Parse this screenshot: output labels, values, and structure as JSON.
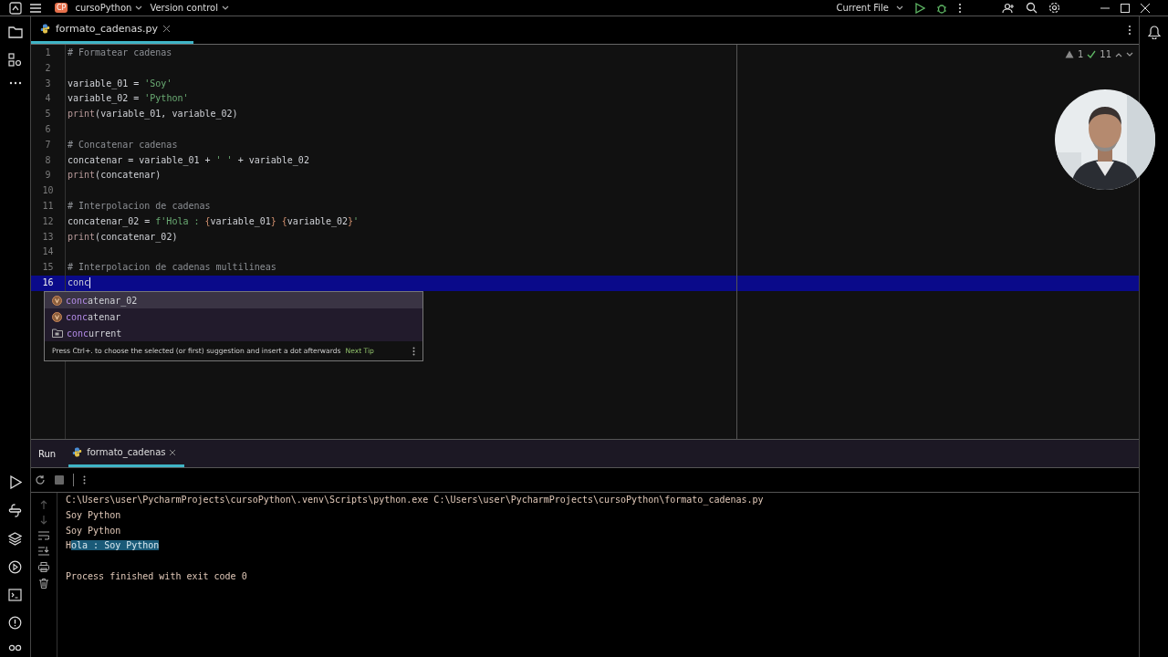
{
  "title_bar": {
    "project_badge": "CP",
    "project": "cursoPython",
    "vcs": "Version control",
    "run_config": "Current File"
  },
  "editor": {
    "tab": {
      "label": "formato_cadenas.py",
      "selected": true
    },
    "inspections": {
      "warnings": "1",
      "ok": "11"
    },
    "lines": [
      {
        "number": "1",
        "current": false,
        "tokens": [
          {
            "kind": "comment",
            "text": "# Formatear cadenas"
          }
        ]
      },
      {
        "number": "2",
        "current": false
      },
      {
        "number": "3",
        "current": false,
        "tokens": [
          {
            "kind": "name",
            "text": "variable_01 = "
          },
          {
            "kind": "string",
            "text": "'Soy'"
          }
        ]
      },
      {
        "number": "4",
        "current": false,
        "tokens": [
          {
            "kind": "name",
            "text": "variable_02 = "
          },
          {
            "kind": "string",
            "text": "'Python'"
          }
        ]
      },
      {
        "number": "5",
        "current": false,
        "tokens": [
          {
            "kind": "func",
            "text": "print"
          },
          {
            "kind": "name",
            "text": "(variable_01, variable_02)"
          }
        ]
      },
      {
        "number": "6",
        "current": false
      },
      {
        "number": "7",
        "current": false,
        "tokens": [
          {
            "kind": "comment",
            "text": "# Concatenar cadenas"
          }
        ]
      },
      {
        "number": "8",
        "current": false,
        "tokens": [
          {
            "kind": "name",
            "text": "concatenar = variable_01 + "
          },
          {
            "kind": "string",
            "text": "' '"
          },
          {
            "kind": "name",
            "text": " + variable_02"
          }
        ]
      },
      {
        "number": "9",
        "current": false,
        "tokens": [
          {
            "kind": "func",
            "text": "print"
          },
          {
            "kind": "name",
            "text": "(concatenar)"
          }
        ]
      },
      {
        "number": "10",
        "current": false
      },
      {
        "number": "11",
        "current": false,
        "tokens": [
          {
            "kind": "comment",
            "text": "# Interpolacion de cadenas"
          }
        ]
      },
      {
        "number": "12",
        "current": false,
        "tokens": [
          {
            "kind": "name",
            "text": "concatenar_02 = "
          },
          {
            "kind": "string",
            "text": "f'Hola : "
          },
          {
            "kind": "brace",
            "text": "{"
          },
          {
            "kind": "name",
            "text": "variable_01"
          },
          {
            "kind": "brace",
            "text": "} {"
          },
          {
            "kind": "name",
            "text": "variable_02"
          },
          {
            "kind": "brace",
            "text": "}"
          },
          {
            "kind": "string",
            "text": "'"
          }
        ]
      },
      {
        "number": "13",
        "current": false,
        "tokens": [
          {
            "kind": "func",
            "text": "print"
          },
          {
            "kind": "name",
            "text": "(concatenar_02)"
          }
        ]
      },
      {
        "number": "14",
        "current": false
      },
      {
        "number": "15",
        "current": false,
        "tokens": [
          {
            "kind": "comment",
            "text": "# Interpolacion de cadenas multilineas"
          }
        ]
      },
      {
        "number": "16",
        "current": true,
        "tokens": [
          {
            "kind": "name",
            "text": "conc"
          }
        ]
      }
    ],
    "completion": {
      "items": [
        {
          "kind": "variable",
          "match": "conc",
          "rest": "atenar_02",
          "selected": true
        },
        {
          "kind": "variable",
          "match": "conc",
          "rest": "atenar",
          "selected": false
        },
        {
          "kind": "package",
          "match": "conc",
          "rest": "urrent",
          "selected": false
        }
      ],
      "hint": "Press Ctrl+. to choose the selected (or first) suggestion and insert a dot afterwards",
      "next_tip": "Next Tip"
    }
  },
  "run_panel": {
    "title": "Run",
    "tab": {
      "label": "formato_cadenas",
      "selected": true
    },
    "output": [
      {
        "parts": [
          {
            "text": "C:\\Users\\user\\PycharmProjects\\cursoPython\\.venv\\Scripts\\python.exe C:\\Users\\user\\PycharmProjects\\cursoPython\\formato_cadenas.py",
            "selected": false
          }
        ]
      },
      {
        "parts": [
          {
            "text": "Soy Python",
            "selected": false
          }
        ]
      },
      {
        "parts": [
          {
            "text": "Soy Python",
            "selected": false
          }
        ]
      },
      {
        "parts": [
          {
            "text": "H",
            "selected": false
          },
          {
            "text": "ola : Soy Python",
            "selected": true
          }
        ]
      },
      {
        "parts": [
          {
            "text": "Process finished with exit code 0",
            "selected": false
          }
        ]
      }
    ]
  }
}
